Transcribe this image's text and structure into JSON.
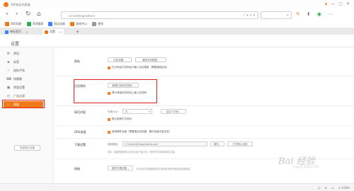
{
  "window": {
    "title": "360安全浏览器",
    "controls": [
      "▾",
      "—",
      "▢",
      "✕"
    ]
  },
  "nav": {
    "back": "‹",
    "forward": "›",
    "reload": "↻",
    "home": "⌂",
    "address": "se:/settings/others",
    "address_icons": "☆ ▾ ⚡ ▾"
  },
  "toolbar_icons": [
    "✎",
    "⬇",
    "◉",
    "⋯"
  ],
  "bookmarks": [
    {
      "label": "360导航",
      "color": "#f07a1a"
    },
    {
      "label": "360搜索",
      "color": "#2eaa55"
    },
    {
      "label": "网址导航",
      "color": "#3b82f6"
    },
    {
      "label": "游戏中心",
      "color": "#f07a1a"
    },
    {
      "label": "更多",
      "color": "#999999"
    }
  ],
  "tabs": [
    {
      "label": "新标签页",
      "color": "#3b82f6",
      "active": false
    },
    {
      "label": "设置",
      "color": "#f07a1a",
      "active": true
    }
  ],
  "tab_add": "+",
  "settings_title": "设置",
  "sidebar": {
    "items": [
      {
        "label": "常用",
        "icon": "⚙"
      },
      {
        "label": "标签",
        "icon": "◈"
      },
      {
        "label": "鼠标手势",
        "icon": "☞"
      },
      {
        "label": "快捷键",
        "icon": "⌨"
      },
      {
        "label": "界面设置",
        "icon": "▣"
      },
      {
        "label": "广告过滤",
        "icon": "◷"
      },
      {
        "label": "高级",
        "icon": "⋯"
      }
    ],
    "active_index": 6,
    "restore_label": "恢复默认设置"
  },
  "main": {
    "sections": {
      "privacy": {
        "label": "隐私",
        "btn1": "内容设置...",
        "btn2": "清除浏览数据...",
        "check": "在已地址栏的网址中输入自动搜索（需要重新启动）"
      },
      "password": {
        "label": "记住密码",
        "btn": "管理已保存的密码...",
        "check": "提示我保存在网页上输入的密码"
      },
      "webcontent": {
        "label": "网页内容",
        "font_label": "字体大小：",
        "font_value": "中",
        "font_btn": "自定义字体...",
        "check": "默认使用中文网页"
      },
      "gpu": {
        "label": "GPU加速",
        "check": "使用硬件加速（需要重启浏览器，硬件加速才能生效）"
      },
      "download": {
        "label": "下载设置",
        "path_label": "保存路径：",
        "path_value": "C:\\Users\\JD\\AppData\\Local",
        "change_btn": "更改...",
        "open_btn": "打开默认目录",
        "hint": "提示: 将始终使用默认保存位置下载文件，修改时可选择新保存位置。"
      },
      "network": {
        "label": "网络",
        "btn": "更改代理设置...",
        "hint": "360安全浏览器使用您计算机的系统代理设置连接网络。"
      }
    }
  },
  "watermark": {
    "text": "Bai 经验",
    "sub": "jingyan.baidu.com"
  },
  "status": {
    "items": [
      "◫",
      "⬇",
      "▭",
      "◷ 100%"
    ]
  }
}
